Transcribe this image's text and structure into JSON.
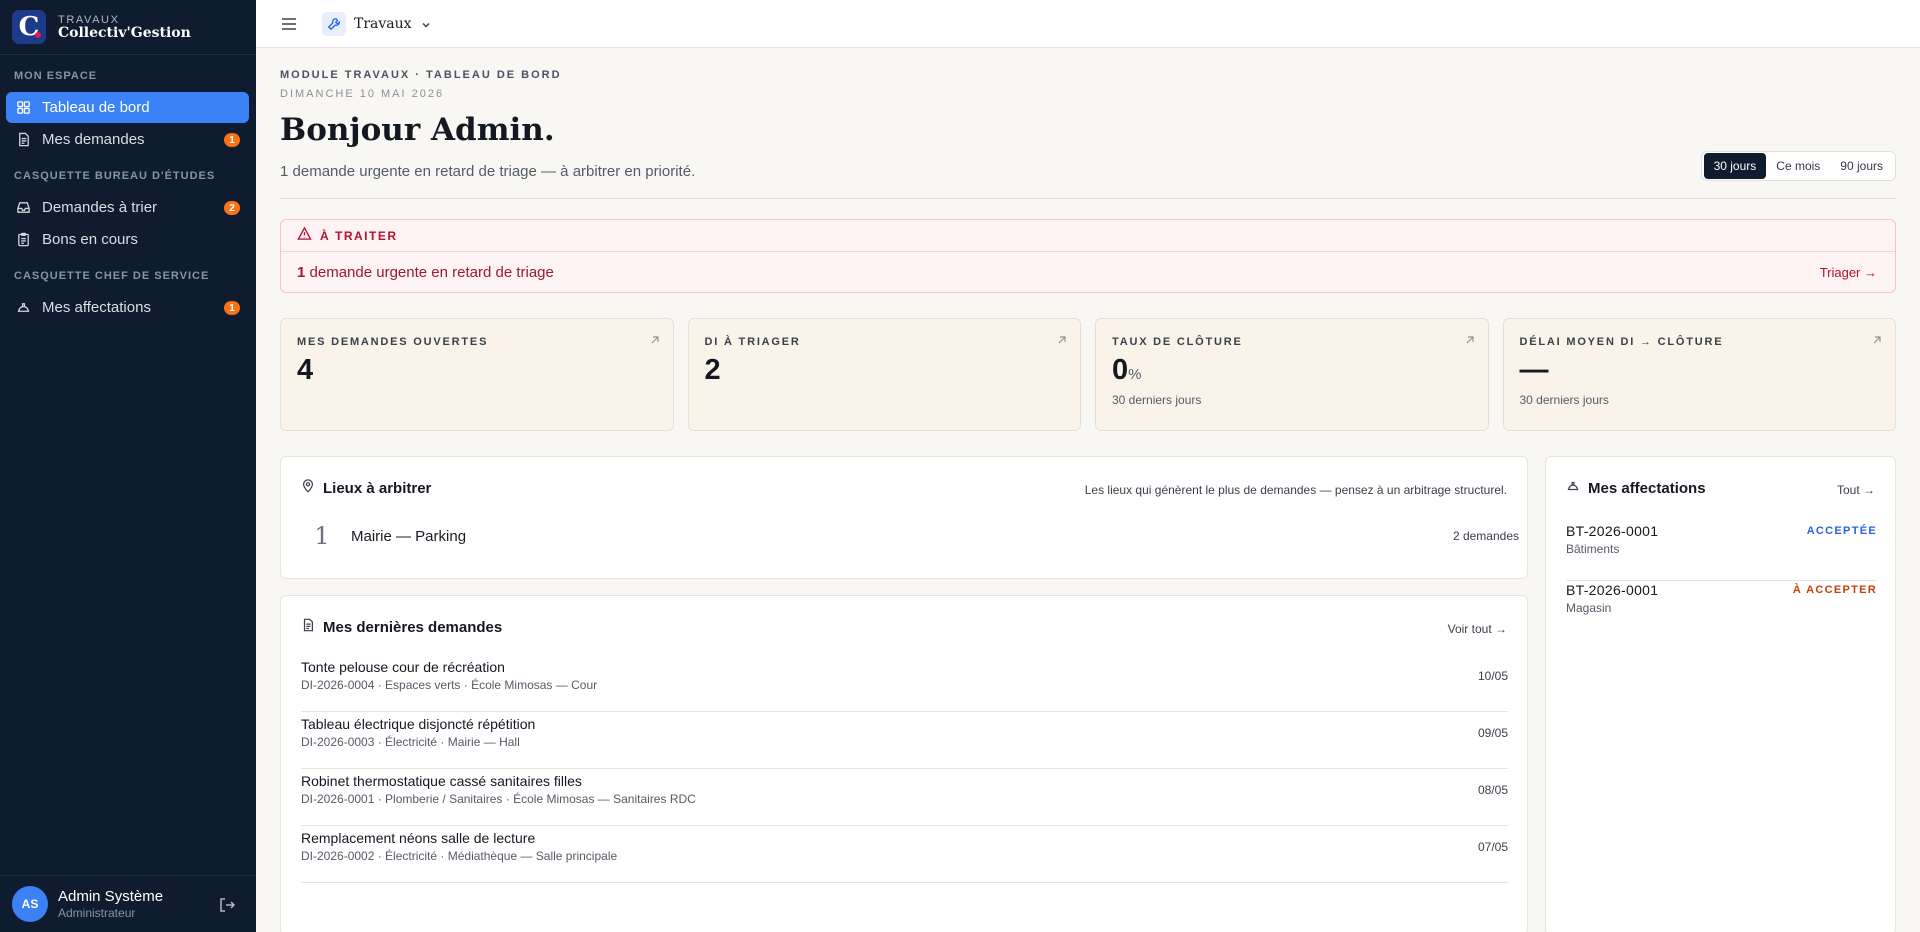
{
  "brand": {
    "logo_letter": "C",
    "module_label": "TRAVAUX",
    "name": "Collectiv'Gestion"
  },
  "sidebar": {
    "sections": [
      {
        "title": "MON ESPACE"
      },
      {
        "title": "CASQUETTE BUREAU D'ÉTUDES"
      },
      {
        "title": "CASQUETTE CHEF DE SERVICE"
      }
    ],
    "items": [
      {
        "label": "Tableau de bord",
        "icon": "grid-icon",
        "active": true
      },
      {
        "label": "Mes demandes",
        "icon": "document-icon",
        "badge": "1"
      },
      {
        "label": "Demandes à trier",
        "icon": "inbox-icon",
        "badge": "2"
      },
      {
        "label": "Bons en cours",
        "icon": "clipboard-icon"
      },
      {
        "label": "Mes affectations",
        "icon": "hardhat-icon",
        "badge": "1"
      }
    ],
    "user": {
      "initials": "AS",
      "name": "Admin Système",
      "role": "Administrateur"
    }
  },
  "topbar": {
    "module": "Travaux"
  },
  "header": {
    "eyebrow": "MODULE TRAVAUX · TABLEAU DE BORD",
    "date": "DIMANCHE 10 MAI 2026",
    "greeting_prefix": "Bonjour ",
    "greeting_name": "Admin",
    "greeting_suffix": ".",
    "subtitle": "1 demande urgente en retard de triage — à arbitrer en priorité.",
    "periods": [
      "30 jours",
      "Ce mois",
      "90 jours"
    ],
    "active_period": "30 jours"
  },
  "alert": {
    "title": "À TRAITER",
    "count": "1",
    "text": " demande urgente en retard de triage",
    "link": "Triager →"
  },
  "kpis": [
    {
      "label": "MES DEMANDES OUVERTES",
      "value": "4",
      "unit": "",
      "sub": ""
    },
    {
      "label": "DI À TRIAGER",
      "value": "2",
      "unit": "",
      "sub": ""
    },
    {
      "label": "TAUX DE CLÔTURE",
      "value": "0",
      "unit": "%",
      "sub": "30 derniers jours"
    },
    {
      "label": "DÉLAI MOYEN DI → CLÔTURE",
      "value": "—",
      "unit": "",
      "sub": "30 derniers jours"
    }
  ],
  "lieux": {
    "title": "Lieux à arbitrer",
    "hint": "Les lieux qui génèrent le plus de demandes — pensez à un arbitrage structurel.",
    "rows": [
      {
        "rank": "1",
        "name": "Mairie — Parking",
        "count": "2 demandes"
      }
    ]
  },
  "demandes": {
    "title": "Mes dernières demandes",
    "link": "Voir tout →",
    "rows": [
      {
        "title": "Tonte pelouse cour de récréation",
        "meta": "DI-2026-0004 · Espaces verts · École Mimosas — Cour",
        "date": "10/05"
      },
      {
        "title": "Tableau électrique disjoncté répétition",
        "meta": "DI-2026-0003 · Électricité · Mairie — Hall",
        "date": "09/05"
      },
      {
        "title": "Robinet thermostatique cassé sanitaires filles",
        "meta": "DI-2026-0001 · Plomberie / Sanitaires · École Mimosas — Sanitaires RDC",
        "date": "08/05"
      },
      {
        "title": "Remplacement néons salle de lecture",
        "meta": "DI-2026-0002 · Électricité · Médiathèque — Salle principale",
        "date": "07/05"
      }
    ]
  },
  "affectations": {
    "title": "Mes affectations",
    "link": "Tout →",
    "rows": [
      {
        "id": "BT-2026-0001",
        "dept": "Bâtiments",
        "status": "ACCEPTÉE",
        "status_color": "#2563eb"
      },
      {
        "id": "BT-2026-0001",
        "dept": "Magasin",
        "status": "À ACCEPTER",
        "status_color": "#c2410c"
      }
    ]
  },
  "colors": {
    "sidebar_bg": "#0f1b2e",
    "accent": "#3b82f6",
    "badge": "#f97316",
    "alert": "#b4122e",
    "kpi_bg": "#f9f3ea"
  }
}
